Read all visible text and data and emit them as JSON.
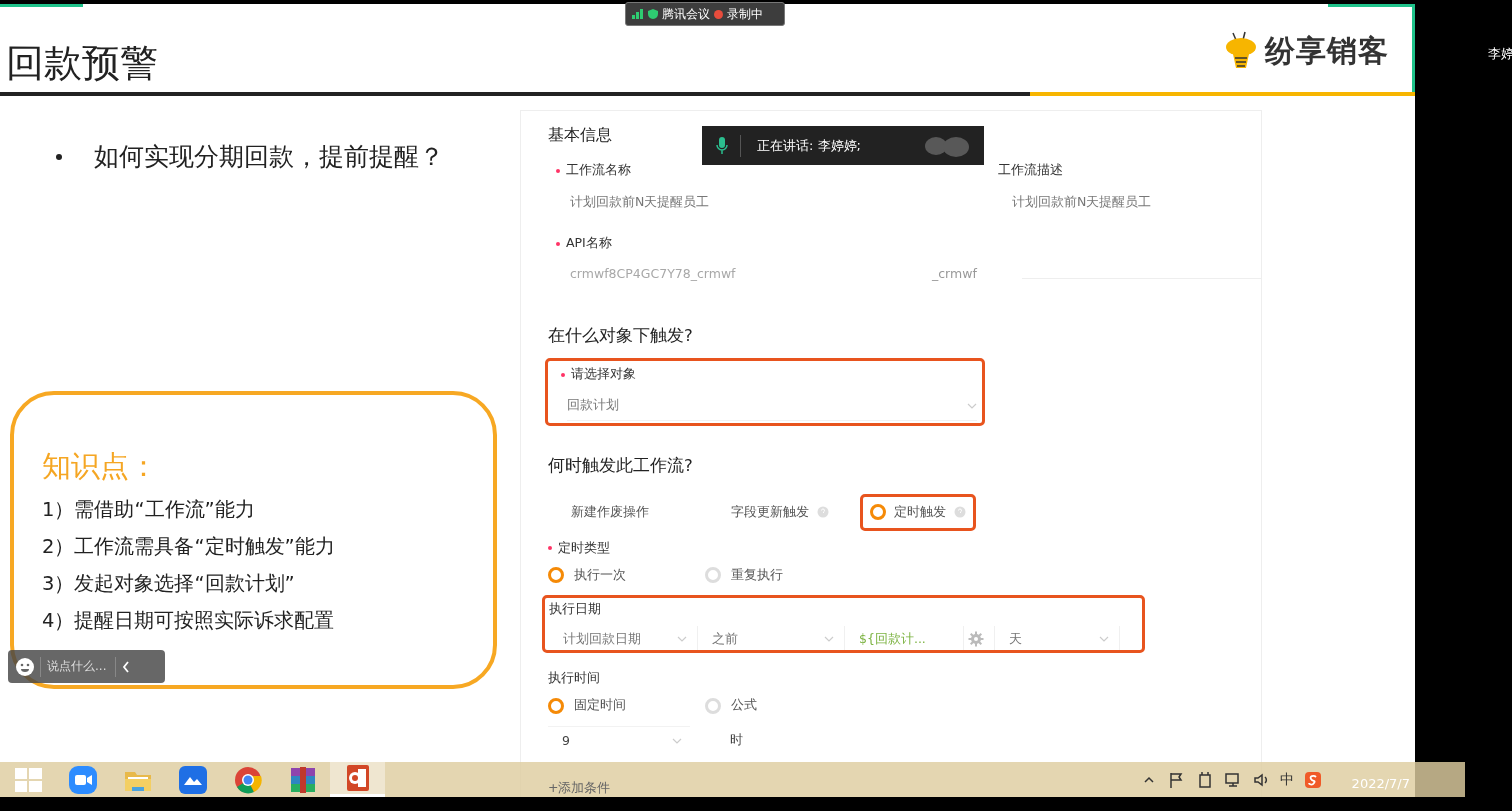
{
  "meeting_bar": {
    "app": "腾讯会议",
    "recording": "录制中"
  },
  "slide": {
    "title": "回款预警",
    "logo_text": "纷享销客",
    "bullet": "如何实现分期回款，提前提醒？",
    "knowledge": {
      "heading": "知识点：",
      "items": [
        "1）需借助“工作流”能力",
        "2）工作流需具备“定时触发”能力",
        "3）发起对象选择“回款计划”",
        "4）提醒日期可按照实际诉求配置"
      ]
    }
  },
  "form": {
    "section_basic": "基本信息",
    "fields": [
      {
        "label": "工作流名称",
        "required": true,
        "value": "计划回款前N天提醒员工"
      },
      {
        "label": "工作流描述",
        "required": false,
        "value": "计划回款前N天提醒员工"
      }
    ],
    "api": {
      "label": "API名称",
      "required": true,
      "value": "crmwf8CP4GC7Y78_crmwf",
      "suffix": "_crmwf"
    },
    "object_section": {
      "title": "在什么对象下触发?",
      "label": "请选择对象",
      "required": true,
      "value": "回款计划",
      "highlighted": true
    },
    "trigger_section": {
      "title": "何时触发此工作流?",
      "options": [
        {
          "label": "新建作废操作",
          "help": false,
          "selected": false,
          "highlighted": false
        },
        {
          "label": "字段更新触发",
          "help": true,
          "selected": false,
          "highlighted": false
        },
        {
          "label": "定时触发",
          "help": true,
          "selected": true,
          "highlighted": true
        }
      ]
    },
    "schedule_type": {
      "label": "定时类型",
      "required": true,
      "options": [
        {
          "label": "执行一次",
          "selected": true
        },
        {
          "label": "重复执行",
          "selected": false
        }
      ]
    },
    "exec_date": {
      "label": "执行日期",
      "highlighted": true,
      "parts": [
        {
          "kind": "select",
          "value": "计划回款日期"
        },
        {
          "kind": "select",
          "value": "之前"
        },
        {
          "kind": "formula",
          "value": "${回款计..."
        },
        {
          "kind": "select",
          "value": "天"
        }
      ]
    },
    "exec_time": {
      "label": "执行时间",
      "options": [
        {
          "label": "固定时间",
          "selected": true
        },
        {
          "label": "公式",
          "selected": false
        }
      ],
      "hour": "9",
      "unit": "时"
    },
    "add_condition": "+添加条件"
  },
  "speaking": {
    "text": "正在讲话: 李婷婷;"
  },
  "chat_input": {
    "placeholder": "说点什么..."
  },
  "side_panel": {
    "name": "李婷"
  },
  "taskbar": {
    "ime": "中",
    "date": "2022/7/7"
  }
}
